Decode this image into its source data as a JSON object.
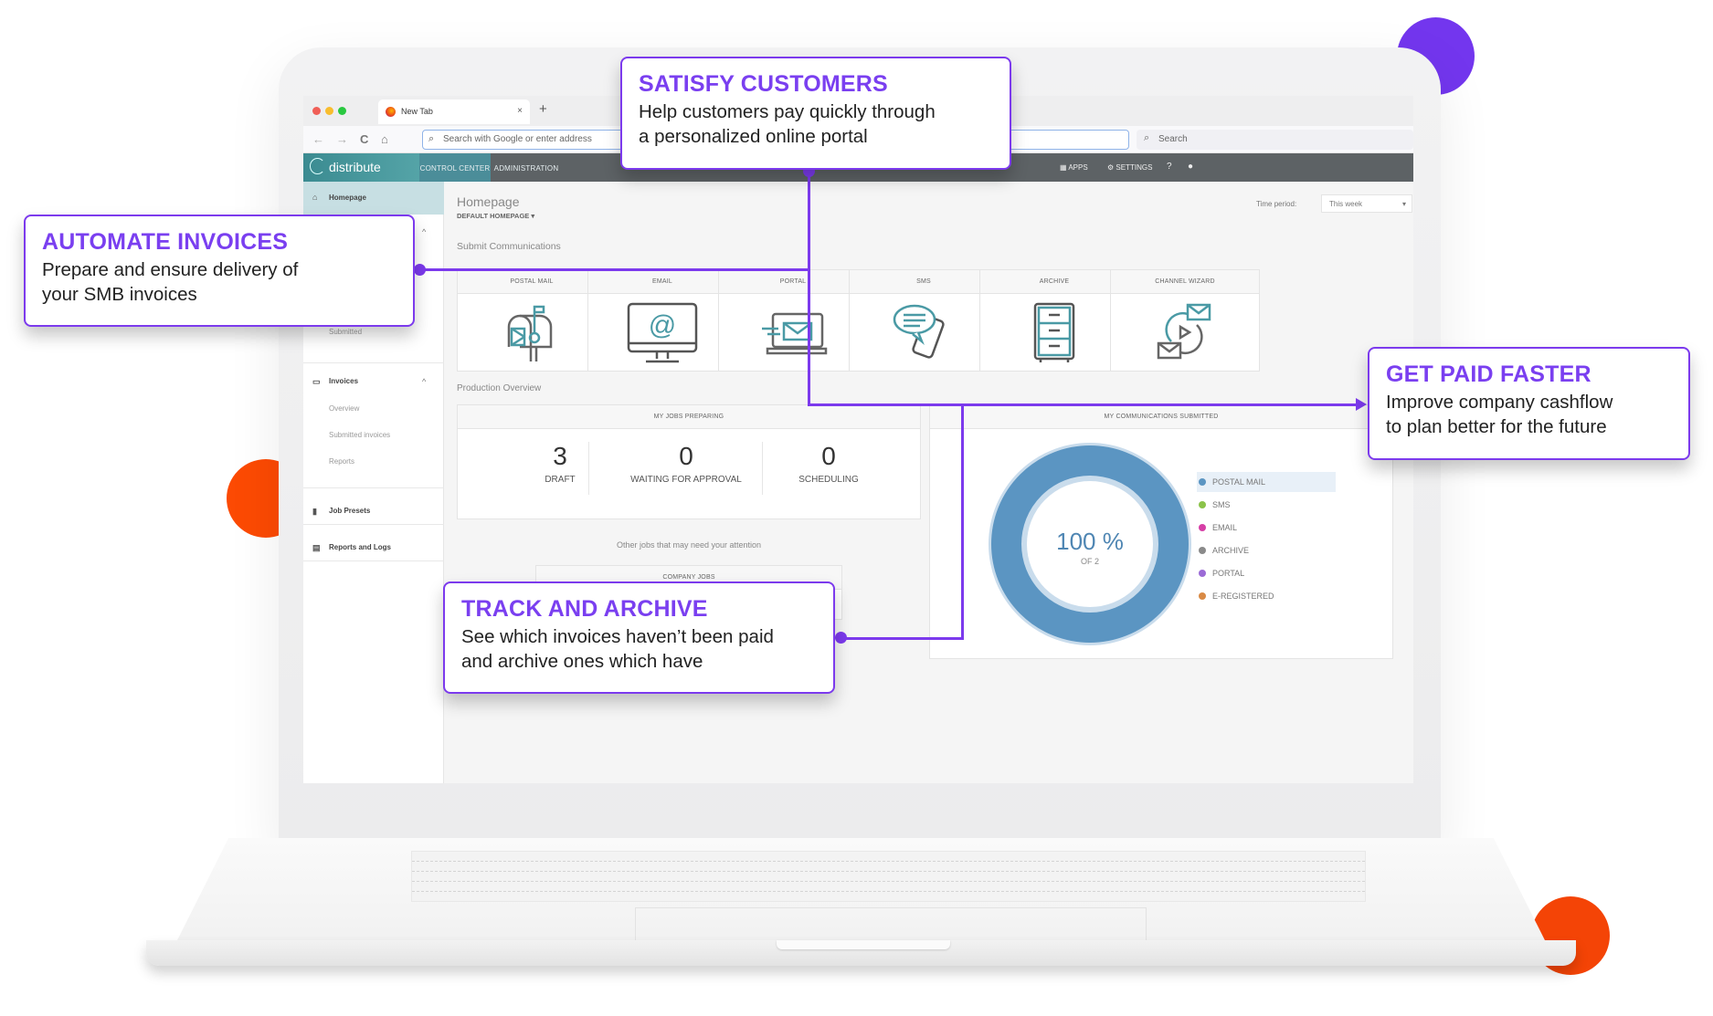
{
  "colors": {
    "accent_purple": "#7c3aed",
    "accent_orange": "#fc4a03",
    "teal_brand": "#4b8d99",
    "donut_blue": "#5b95c2"
  },
  "browser": {
    "tab_title": "New Tab",
    "tab_close": "×",
    "new_tab": "+",
    "back": "←",
    "forward": "→",
    "reload": "C",
    "home": "⌂",
    "address_placeholder": "Search with Google or enter address",
    "search_placeholder": "Search"
  },
  "app": {
    "brand": "distribute",
    "nav_tabs": [
      {
        "label": "CONTROL CENTER",
        "active": true
      },
      {
        "label": "ADMINISTRATION",
        "active": false
      }
    ],
    "nav_right": {
      "apps": "APPS",
      "settings": "SETTINGS",
      "help": "?",
      "user_icon": "user-icon"
    }
  },
  "sidebar": {
    "homepage": "Homepage",
    "submitted": "Submitted",
    "invoices": {
      "label": "Invoices",
      "items": [
        "Overview",
        "Submitted invoices",
        "Reports"
      ]
    },
    "job_presets": "Job Presets",
    "reports_logs": "Reports and Logs"
  },
  "main": {
    "title": "Homepage",
    "subtitle": "DEFAULT HOMEPAGE ▾",
    "time_period_label": "Time period:",
    "time_period_value": "This week",
    "submit_section": "Submit Communications",
    "channels": [
      {
        "label": "POSTAL MAIL",
        "icon": "mailbox-icon"
      },
      {
        "label": "EMAIL",
        "icon": "monitor-at-icon"
      },
      {
        "label": "PORTAL",
        "icon": "laptop-envelope-icon"
      },
      {
        "label": "SMS",
        "icon": "phone-chat-icon"
      },
      {
        "label": "ARCHIVE",
        "icon": "filing-cabinet-icon"
      },
      {
        "label": "CHANNEL WIZARD",
        "icon": "envelope-cycle-icon"
      }
    ],
    "production_section": "Production Overview",
    "jobs_panel": {
      "title": "MY JOBS PREPARING",
      "stats": [
        {
          "value": "3",
          "label": "DRAFT"
        },
        {
          "value": "0",
          "label": "WAITING FOR APPROVAL"
        },
        {
          "value": "0",
          "label": "SCHEDULING"
        }
      ]
    },
    "attention_text": "Other jobs that may need your attention",
    "company_jobs_title": "COMPANY JOBS",
    "comms_panel": {
      "title": "MY COMMUNICATIONS SUBMITTED",
      "center_value": "100 %",
      "center_sub": "OF 2"
    }
  },
  "chart_data": {
    "type": "pie",
    "title": "MY COMMUNICATIONS SUBMITTED",
    "total": 2,
    "categories": [
      "POSTAL MAIL",
      "SMS",
      "EMAIL",
      "ARCHIVE",
      "PORTAL",
      "E-REGISTERED"
    ],
    "values": [
      2,
      0,
      0,
      0,
      0,
      0
    ],
    "percent": [
      100,
      0,
      0,
      0,
      0,
      0
    ],
    "colors": [
      "#5b95c2",
      "#8bc34a",
      "#d63fa6",
      "#8a8a8a",
      "#9b6bd6",
      "#d98a45"
    ],
    "legend": "right",
    "highlighted": "POSTAL MAIL"
  },
  "callouts": [
    {
      "id": "satisfy",
      "title": "SATISFY CUSTOMERS",
      "lines": [
        "Help customers pay quickly through",
        "a personalized online portal"
      ]
    },
    {
      "id": "automate",
      "title": "AUTOMATE INVOICES",
      "lines": [
        "Prepare and ensure delivery of",
        "your SMB invoices"
      ]
    },
    {
      "id": "getpaid",
      "title": "GET PAID FASTER",
      "lines": [
        "Improve company cashflow",
        "to plan better for the future"
      ]
    },
    {
      "id": "track",
      "title": "TRACK AND ARCHIVE",
      "lines": [
        "See which invoices haven’t been paid",
        "and archive ones which have"
      ]
    }
  ]
}
